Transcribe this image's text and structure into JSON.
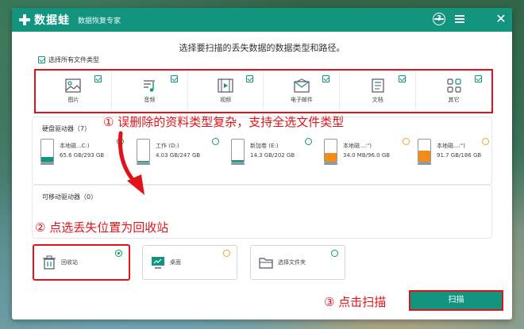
{
  "app": {
    "name": "数据蛙",
    "subtitle": "数据恢复专家"
  },
  "titlebar": {
    "help": "?",
    "close": "✕"
  },
  "heading": "选择要扫描的丢失数据的数据类型和路径。",
  "select_all_label": "选择所有文件类型",
  "file_types": [
    {
      "label": "图片",
      "icon": "image-icon",
      "checked": true
    },
    {
      "label": "音频",
      "icon": "music-icon",
      "checked": true
    },
    {
      "label": "视频",
      "icon": "video-icon",
      "checked": true
    },
    {
      "label": "电子邮件",
      "icon": "email-icon",
      "checked": true
    },
    {
      "label": "文档",
      "icon": "document-icon",
      "checked": true
    },
    {
      "label": "其它",
      "icon": "grid-icon",
      "checked": true
    }
  ],
  "annotations": {
    "step1": "① 误删除的资料类型复杂，支持全选文件类型",
    "step2": "② 点选丢失位置为回收站",
    "step3": "③ 点击扫描"
  },
  "hard_drives": {
    "title": "硬盘驱动器（7）",
    "drives": [
      {
        "name": "本地磁...C:)",
        "size": "65.6 GB/293 GB",
        "usage": 0.22,
        "warn": false
      },
      {
        "name": "工作 (D:)",
        "size": "4.03 GB/247 GB",
        "usage": 0.02,
        "warn": false
      },
      {
        "name": "新加卷 (E:)",
        "size": "14.3 GB/202 GB",
        "usage": 0.07,
        "warn": false
      },
      {
        "name": "本地磁...:\")",
        "size": "34.0 MB/96.0 GB",
        "usage": 0.4,
        "warn": true
      },
      {
        "name": "本地磁...:\")",
        "size": "91.7 GB/186 GB",
        "usage": 0.49,
        "warn": true
      }
    ]
  },
  "removable": {
    "title": "可移动驱动器（0）"
  },
  "locations": [
    {
      "label": "回收站",
      "icon": "recycle-bin-icon",
      "selected": true
    },
    {
      "label": "桌面",
      "icon": "desktop-icon",
      "selected": false
    },
    {
      "label": "选择文件夹",
      "icon": "folder-icon",
      "selected": false
    }
  ],
  "scan_label": "扫描",
  "colors": {
    "brand": "#12947f",
    "annotation": "#e0131b",
    "warning": "#f28c1a"
  }
}
